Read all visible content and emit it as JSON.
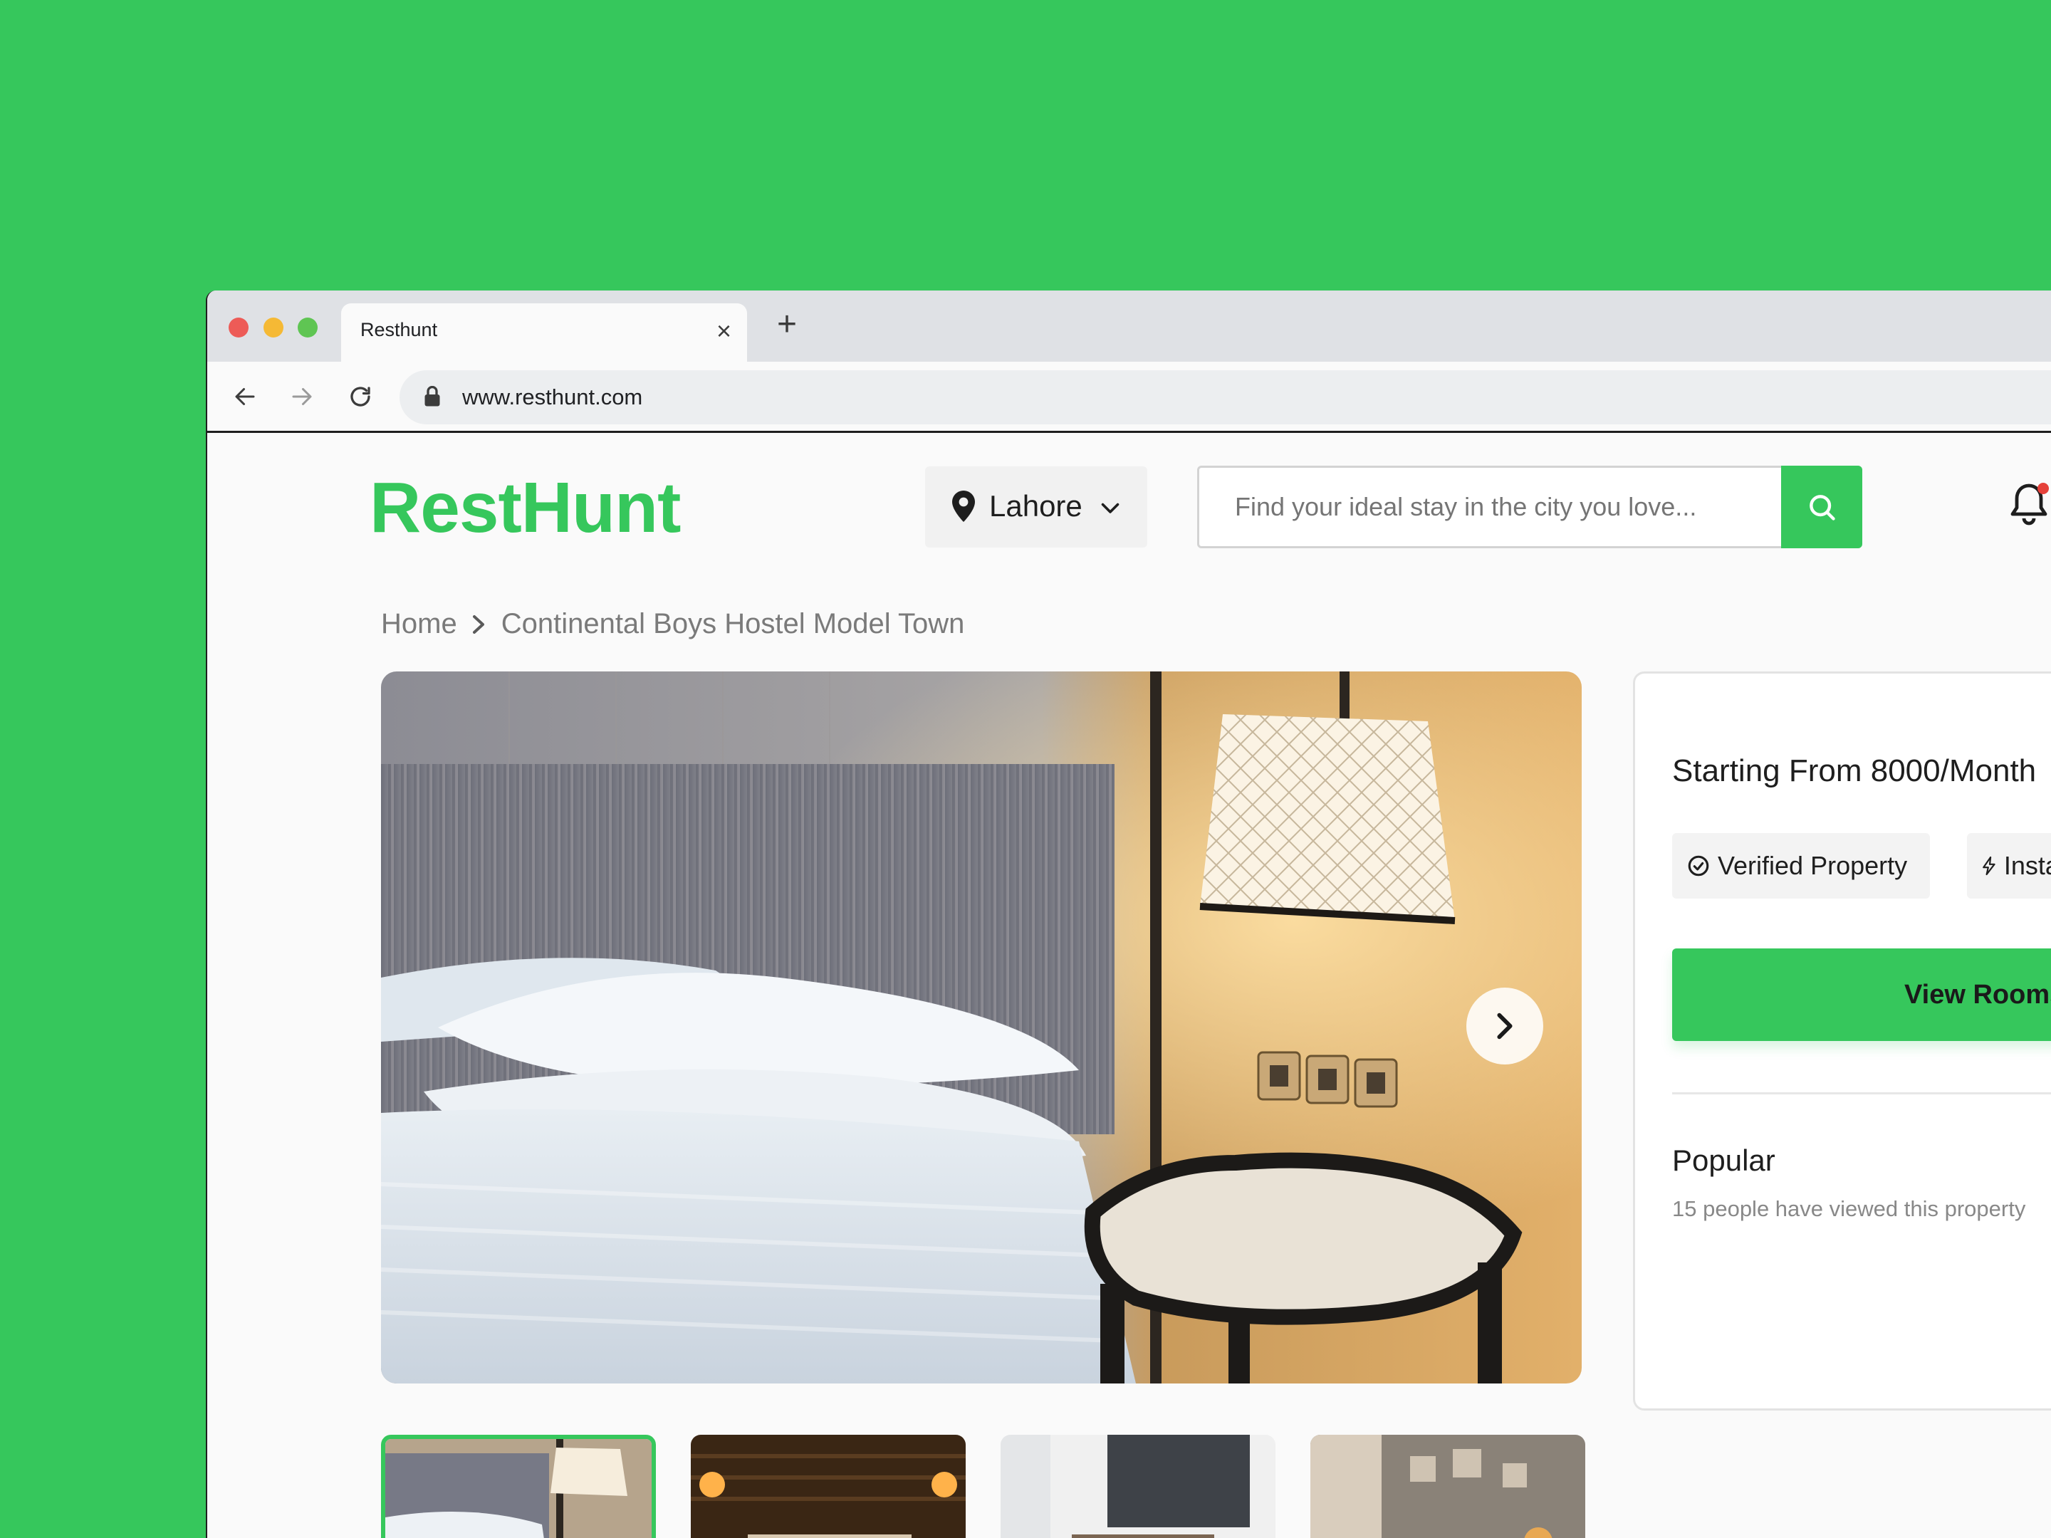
{
  "browser": {
    "tab_title": "Resthunt",
    "url": "www.resthunt.com"
  },
  "site": {
    "logo": "RestHunt",
    "city": "Lahore",
    "search_placeholder": "Find your ideal stay in the city you love..."
  },
  "breadcrumb": {
    "home": "Home",
    "current": "Continental Boys Hostel Model Town"
  },
  "listing": {
    "price": "Starting From 8000/Month",
    "badges": [
      "Verified Property",
      "Instant Booking"
    ],
    "view_rooms_label": "View Rooms",
    "popular_title": "Popular",
    "popular_text": "15 people have viewed this property"
  },
  "gallery": {
    "thumbnails": [
      "Bedroom with lamp",
      "Warm lit bedroom",
      "Modern room",
      "Living area"
    ],
    "active_index": 0
  },
  "colors": {
    "background": "#36c75c",
    "brand": "#36c75c",
    "notification_dot": "#e5413a"
  },
  "icons": [
    "back-icon",
    "forward-icon",
    "reload-icon",
    "lock-icon",
    "location-pin-icon",
    "chevron-down-icon",
    "search-icon",
    "bell-icon",
    "chevron-right-icon",
    "check-circle-icon",
    "lightning-icon"
  ]
}
